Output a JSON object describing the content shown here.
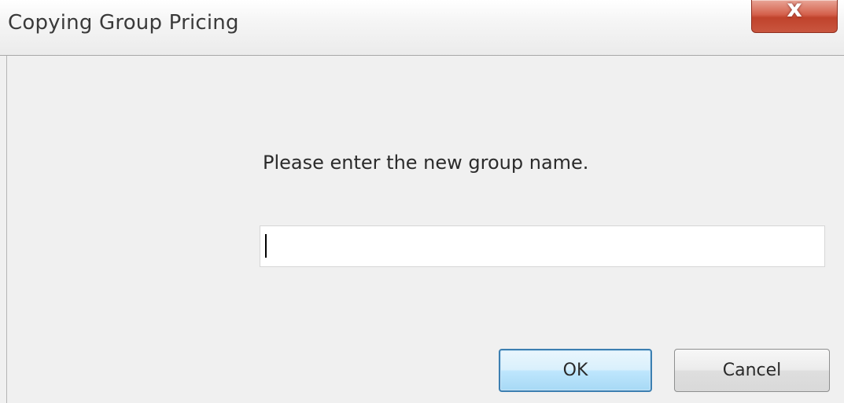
{
  "window": {
    "title": "Copying Group Pricing",
    "close_glyph": "x"
  },
  "dialog": {
    "prompt": "Please enter the new group name.",
    "input_value": "",
    "ok_label": "OK",
    "cancel_label": "Cancel"
  },
  "colors": {
    "close_button": "#c9563f",
    "default_button_border": "#3c7fb1",
    "dialog_background": "#f0f0f0"
  },
  "icons": {
    "close": "close-icon"
  }
}
